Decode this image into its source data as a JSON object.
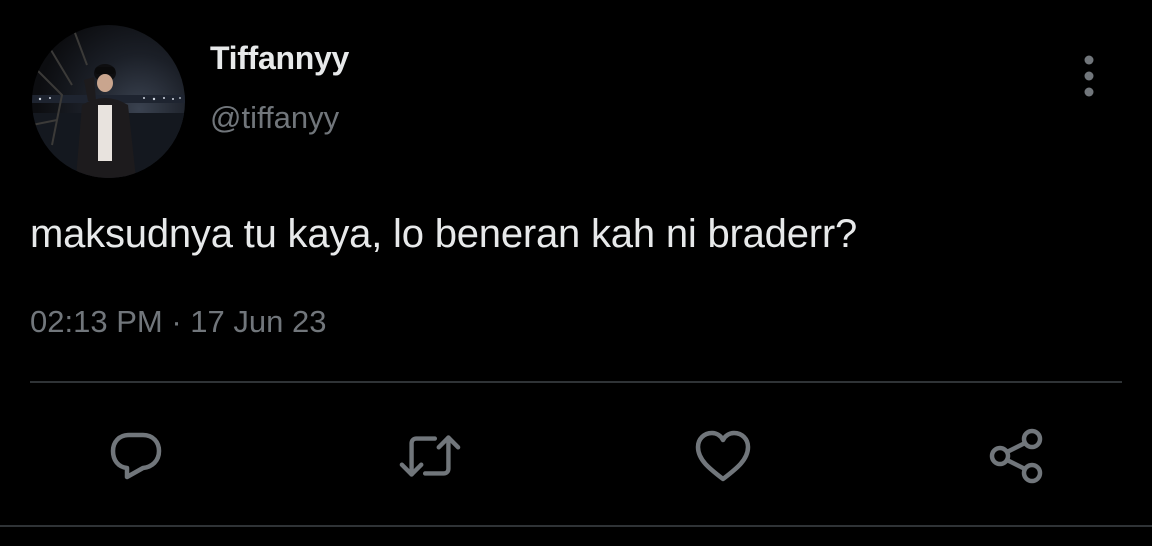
{
  "tweet": {
    "author": {
      "display_name": "Tiffannyy",
      "handle": "@tiffanyy",
      "avatar": "profile-photo-night-lakeside"
    },
    "text": "maksudnya tu kaya, lo beneran kah ni braderr?",
    "time": "02:13 PM",
    "separator": "·",
    "date": "17 Jun 23"
  },
  "actions": [
    {
      "icon": "reply-icon"
    },
    {
      "icon": "retweet-icon"
    },
    {
      "icon": "like-icon"
    },
    {
      "icon": "share-icon"
    }
  ],
  "menu": {
    "icon": "more-vertical-icon"
  },
  "colors": {
    "background": "#000000",
    "primary_text": "#e7e9ea",
    "secondary_text": "#71767b",
    "divider": "#2f3336"
  }
}
